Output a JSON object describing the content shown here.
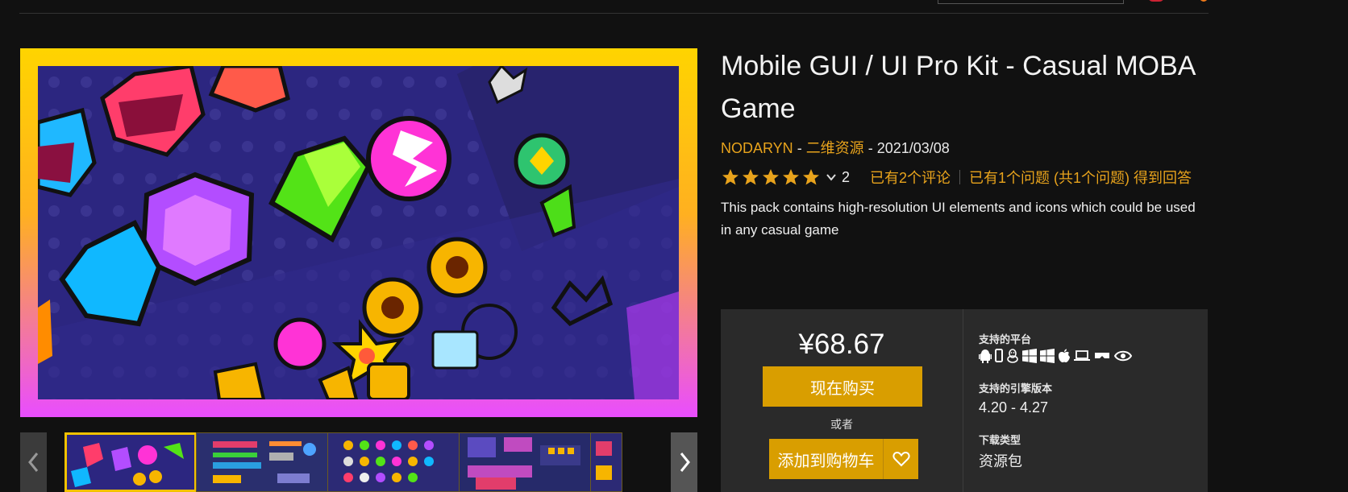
{
  "product": {
    "title": "Mobile GUI / UI Pro Kit - Casual MOBA Game",
    "publisher": "NODARYN",
    "category": "二维资源",
    "date": "2021/03/08",
    "meta_separator": " - ",
    "rating": {
      "stars": 5,
      "count": "2",
      "reviews_text": "已有2个评论",
      "questions_text": "已有1个问题 (共1个问题) 得到回答"
    },
    "description": "This pack contains high-resolution UI elements and icons which could be used in any casual game"
  },
  "purchase": {
    "price": "¥68.67",
    "buy_now_label": "现在购买",
    "or_label": "或者",
    "add_to_cart_label": "添加到购物车"
  },
  "details": {
    "platforms_label": "支持的平台",
    "platform_icons": [
      "android-icon",
      "mobile-icon",
      "linux-icon",
      "windows-icon",
      "windows-store-icon",
      "apple-icon",
      "laptop-icon",
      "vr-headset-icon",
      "eye-icon"
    ],
    "engine_label": "支持的引擎版本",
    "engine_value": "4.20 - 4.27",
    "download_label": "下载类型",
    "download_value": "资源包"
  },
  "gallery": {
    "thumbnail_count": 5,
    "active_index": 0
  },
  "colors": {
    "accent": "#d99e00",
    "link": "#e8a31c",
    "background": "#111111",
    "panel": "#2a2a2a"
  }
}
